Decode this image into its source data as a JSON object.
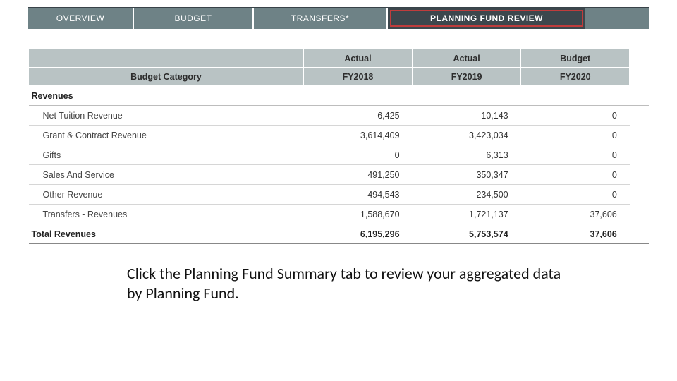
{
  "tabs": {
    "overview": "OVERVIEW",
    "budget": "BUDGET",
    "transfers": "TRANSFERS*",
    "pfr": "PLANNING FUND REVIEW"
  },
  "headers": {
    "budget_category": "Budget Category",
    "col1_top": "Actual",
    "col1_bot": "FY2018",
    "col2_top": "Actual",
    "col2_bot": "FY2019",
    "col3_top": "Budget",
    "col3_bot": "FY2020"
  },
  "section": {
    "revenues": "Revenues"
  },
  "rows": [
    {
      "label": "Net Tuition Revenue",
      "c1": "6,425",
      "c2": "10,143",
      "c3": "0"
    },
    {
      "label": "Grant & Contract Revenue",
      "c1": "3,614,409",
      "c2": "3,423,034",
      "c3": "0"
    },
    {
      "label": "Gifts",
      "c1": "0",
      "c2": "6,313",
      "c3": "0"
    },
    {
      "label": "Sales And Service",
      "c1": "491,250",
      "c2": "350,347",
      "c3": "0"
    },
    {
      "label": "Other Revenue",
      "c1": "494,543",
      "c2": "234,500",
      "c3": "0"
    },
    {
      "label": "Transfers - Revenues",
      "c1": "1,588,670",
      "c2": "1,721,137",
      "c3": "37,606"
    }
  ],
  "total": {
    "label": "Total Revenues",
    "c1": "6,195,296",
    "c2": "5,753,574",
    "c3": "37,606"
  },
  "caption": "Click the Planning Fund Summary tab to review your aggregated data by Planning Fund."
}
